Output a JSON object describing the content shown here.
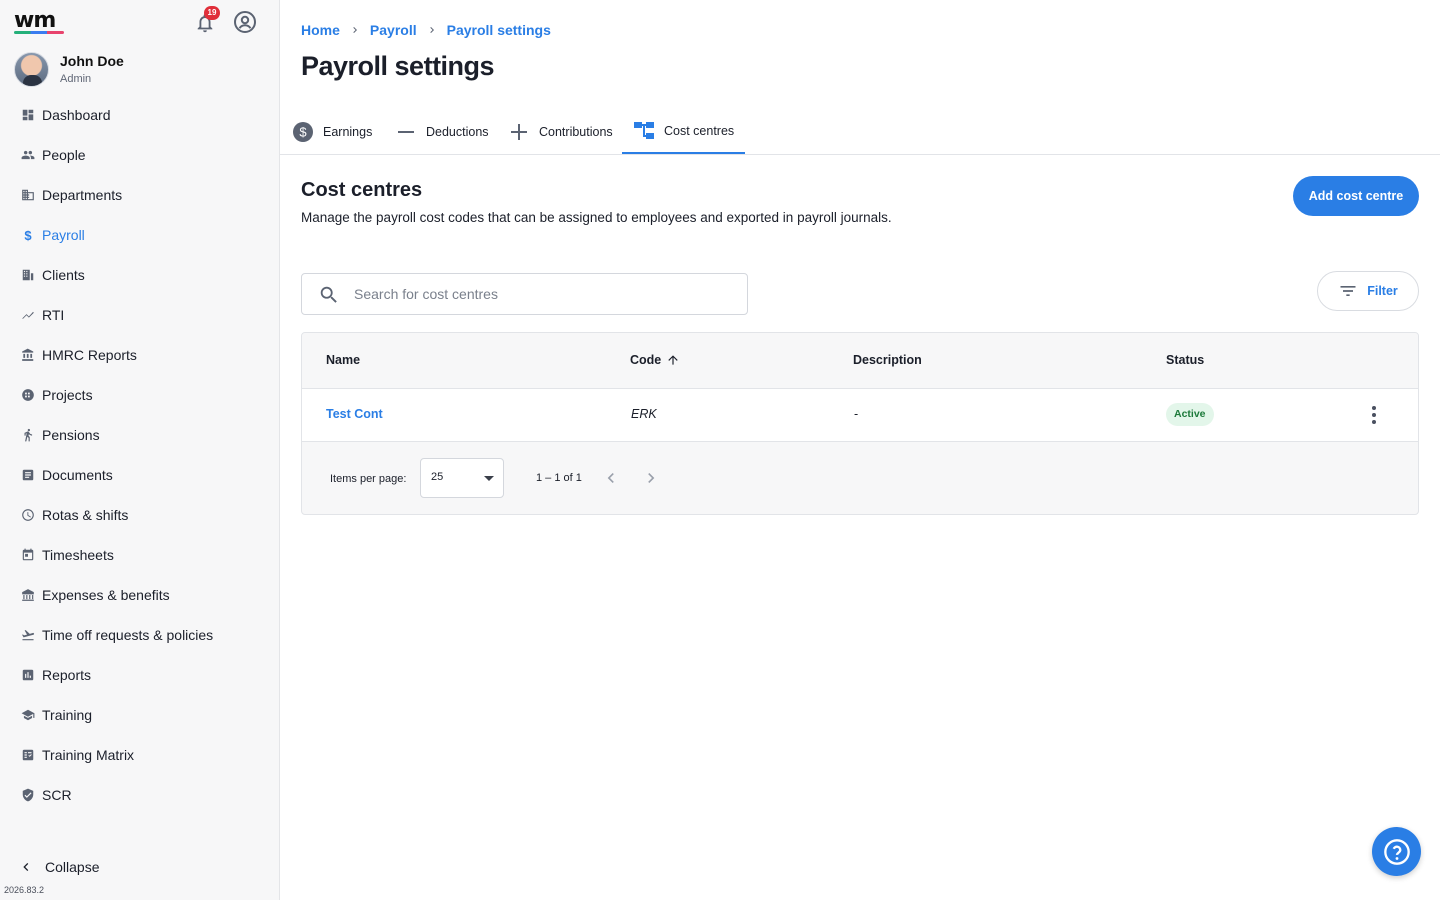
{
  "app": {
    "logo_text": "wm",
    "notifications_count": "19",
    "version": "2026.83.2"
  },
  "user": {
    "name": "John Doe",
    "role": "Admin"
  },
  "sidebar": {
    "items": [
      {
        "label": "Dashboard",
        "icon": "dashboard-icon"
      },
      {
        "label": "People",
        "icon": "people-icon"
      },
      {
        "label": "Departments",
        "icon": "departments-icon"
      },
      {
        "label": "Payroll",
        "icon": "dollar-icon",
        "active": true
      },
      {
        "label": "Clients",
        "icon": "clients-icon"
      },
      {
        "label": "RTI",
        "icon": "trend-icon"
      },
      {
        "label": "HMRC Reports",
        "icon": "bank-icon"
      },
      {
        "label": "Projects",
        "icon": "projects-icon"
      },
      {
        "label": "Pensions",
        "icon": "pensions-icon"
      },
      {
        "label": "Documents",
        "icon": "documents-icon"
      },
      {
        "label": "Rotas & shifts",
        "icon": "clock-icon"
      },
      {
        "label": "Timesheets",
        "icon": "calendar-icon"
      },
      {
        "label": "Expenses & benefits",
        "icon": "expenses-icon"
      },
      {
        "label": "Time off requests & policies",
        "icon": "plane-icon"
      },
      {
        "label": "Reports",
        "icon": "reports-icon"
      },
      {
        "label": "Training",
        "icon": "graduation-icon"
      },
      {
        "label": "Training Matrix",
        "icon": "matrix-icon"
      },
      {
        "label": "SCR",
        "icon": "shield-icon"
      }
    ],
    "collapse_label": "Collapse"
  },
  "breadcrumb": [
    "Home",
    "Payroll",
    "Payroll settings"
  ],
  "page_title": "Payroll settings",
  "tabs": [
    {
      "label": "Earnings",
      "icon": "dollar-circle-icon"
    },
    {
      "label": "Deductions",
      "icon": "minus-icon"
    },
    {
      "label": "Contributions",
      "icon": "plus-icon"
    },
    {
      "label": "Cost centres",
      "icon": "hierarchy-icon",
      "active": true
    }
  ],
  "section": {
    "title": "Cost centres",
    "description": "Manage the payroll cost codes that can be assigned to employees and exported in payroll journals.",
    "add_button": "Add cost centre"
  },
  "search": {
    "placeholder": "Search for cost centres"
  },
  "filter_label": "Filter",
  "table": {
    "columns": [
      "Name",
      "Code",
      "Description",
      "Status"
    ],
    "sort_column": "Code",
    "sort_direction": "ascending",
    "rows": [
      {
        "name": "Test Cont",
        "code": "ERK",
        "description": "-",
        "status": "Active"
      }
    ]
  },
  "pagination": {
    "items_per_page_label": "Items per page:",
    "items_per_page": "25",
    "range": "1 – 1 of 1"
  },
  "colors": {
    "accent": "#2a7ee5",
    "status_active_bg": "#e3f6ea",
    "status_active_text": "#1d7a3b",
    "badge": "#e02f3a"
  }
}
